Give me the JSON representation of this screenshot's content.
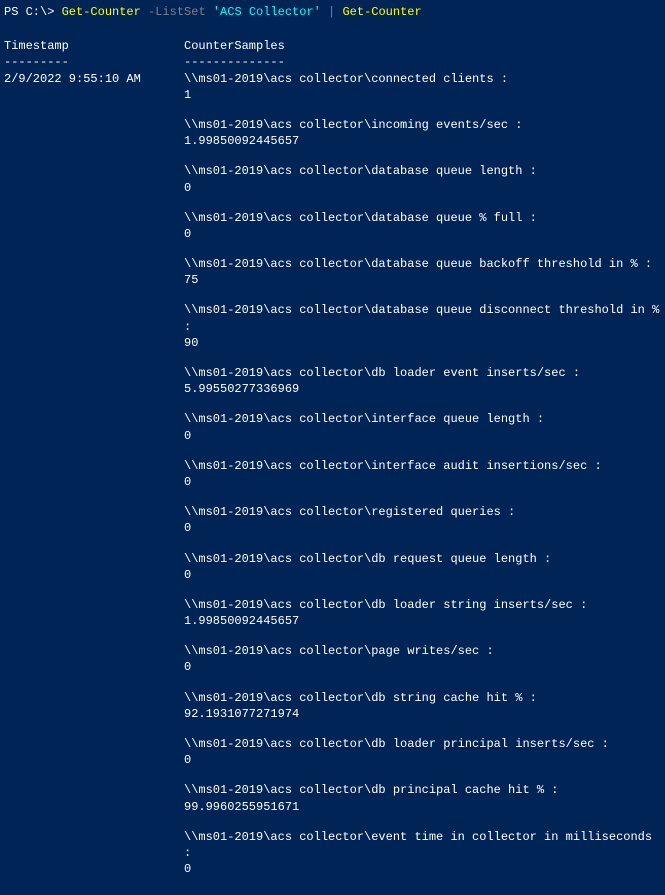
{
  "prompt": {
    "prefix": "PS C:\\> ",
    "cmd1": "Get-Counter",
    "param": " -ListSet",
    "arg": " 'ACS Collector'",
    "pipe": " | ",
    "cmd2": "Get-Counter"
  },
  "headers": {
    "timestamp": "Timestamp",
    "samples": "CounterSamples"
  },
  "dividers": {
    "timestamp": "---------",
    "samples": "--------------"
  },
  "timestamp": "2/9/2022 9:55:10 AM",
  "counters": [
    {
      "path": "\\\\ms01-2019\\acs collector\\connected clients :",
      "value": "1"
    },
    {
      "path": "\\\\ms01-2019\\acs collector\\incoming events/sec :",
      "value": "1.99850092445657"
    },
    {
      "path": "\\\\ms01-2019\\acs collector\\database queue length :",
      "value": "0"
    },
    {
      "path": "\\\\ms01-2019\\acs collector\\database queue % full :",
      "value": "0"
    },
    {
      "path": "\\\\ms01-2019\\acs collector\\database queue backoff threshold in % :",
      "value": "75"
    },
    {
      "path": "\\\\ms01-2019\\acs collector\\database queue disconnect threshold in % :",
      "value": "90"
    },
    {
      "path": "\\\\ms01-2019\\acs collector\\db loader event inserts/sec :",
      "value": "5.99550277336969"
    },
    {
      "path": "\\\\ms01-2019\\acs collector\\interface queue length :",
      "value": "0"
    },
    {
      "path": "\\\\ms01-2019\\acs collector\\interface audit insertions/sec :",
      "value": "0"
    },
    {
      "path": "\\\\ms01-2019\\acs collector\\registered queries :",
      "value": "0"
    },
    {
      "path": "\\\\ms01-2019\\acs collector\\db request queue length :",
      "value": "0"
    },
    {
      "path": "\\\\ms01-2019\\acs collector\\db loader string inserts/sec :",
      "value": "1.99850092445657"
    },
    {
      "path": "\\\\ms01-2019\\acs collector\\page writes/sec :",
      "value": "0"
    },
    {
      "path": "\\\\ms01-2019\\acs collector\\db string cache hit % :",
      "value": "92.1931077271974"
    },
    {
      "path": "\\\\ms01-2019\\acs collector\\db loader principal inserts/sec :",
      "value": "0"
    },
    {
      "path": "\\\\ms01-2019\\acs collector\\db principal cache hit % :",
      "value": "99.9960255951671"
    },
    {
      "path": "\\\\ms01-2019\\acs collector\\event time in collector in milliseconds :",
      "value": "0"
    }
  ]
}
